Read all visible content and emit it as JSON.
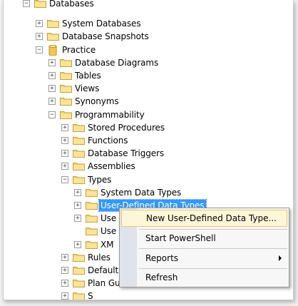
{
  "tree": [
    {
      "label": "Databases",
      "level": 0,
      "expander": "minus",
      "icon": "folder"
    },
    {
      "label": "System Databases",
      "level": 1,
      "expander": "plus",
      "icon": "folder"
    },
    {
      "label": "Database Snapshots",
      "level": 1,
      "expander": "plus",
      "icon": "folder"
    },
    {
      "label": "Practice",
      "level": 1,
      "expander": "minus",
      "icon": "database"
    },
    {
      "label": "Database Diagrams",
      "level": 2,
      "expander": "plus",
      "icon": "folder"
    },
    {
      "label": "Tables",
      "level": 2,
      "expander": "plus",
      "icon": "folder"
    },
    {
      "label": "Views",
      "level": 2,
      "expander": "plus",
      "icon": "folder"
    },
    {
      "label": "Synonyms",
      "level": 2,
      "expander": "plus",
      "icon": "folder"
    },
    {
      "label": "Programmability",
      "level": 2,
      "expander": "minus",
      "icon": "folder"
    },
    {
      "label": "Stored Procedures",
      "level": 3,
      "expander": "plus",
      "icon": "folder"
    },
    {
      "label": "Functions",
      "level": 3,
      "expander": "plus",
      "icon": "folder"
    },
    {
      "label": "Database Triggers",
      "level": 3,
      "expander": "plus",
      "icon": "folder"
    },
    {
      "label": "Assemblies",
      "level": 3,
      "expander": "plus",
      "icon": "folder"
    },
    {
      "label": "Types",
      "level": 3,
      "expander": "minus",
      "icon": "folder"
    },
    {
      "label": "System Data Types",
      "level": 4,
      "expander": "plus",
      "icon": "folder"
    },
    {
      "label": "User-Defined Data Types",
      "level": 4,
      "expander": "plus",
      "icon": "folder",
      "selected": true
    },
    {
      "label": "Use",
      "level": 4,
      "expander": "plus",
      "icon": "folder"
    },
    {
      "label": "Use",
      "level": 4,
      "expander": "none",
      "icon": "folder"
    },
    {
      "label": "XM",
      "level": 4,
      "expander": "plus",
      "icon": "folder"
    },
    {
      "label": "Rules",
      "level": 3,
      "expander": "plus",
      "icon": "folder"
    },
    {
      "label": "Default",
      "level": 3,
      "expander": "plus",
      "icon": "folder"
    },
    {
      "label": "Plan Gu",
      "level": 3,
      "expander": "plus",
      "icon": "folder"
    },
    {
      "label": "S",
      "level": 3,
      "expander": "plus",
      "icon": "folder"
    }
  ],
  "context_menu": {
    "new_udt": "New User-Defined Data Type...",
    "start_powershell": "Start PowerShell",
    "reports": "Reports",
    "refresh": "Refresh"
  },
  "colors": {
    "selection": "#3399ff",
    "menu_highlight": "#fdf6d8",
    "menu_highlight_border": "#e7c86a",
    "folder": "#f4d36b"
  }
}
